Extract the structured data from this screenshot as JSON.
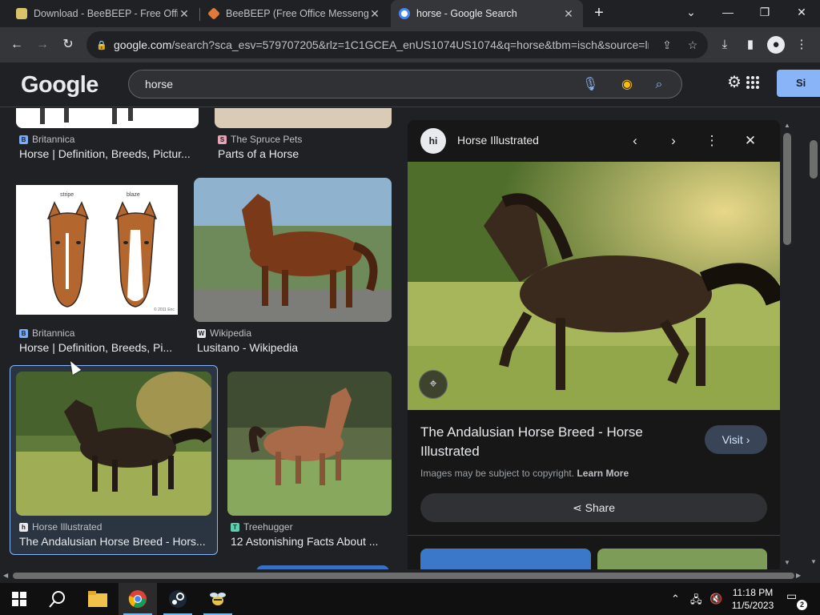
{
  "browser": {
    "tabs": [
      {
        "title": "Download - BeeBEEP - Free Offic"
      },
      {
        "title": "BeeBEEP (Free Office Messenger"
      },
      {
        "title": "horse - Google Search"
      }
    ],
    "url_host": "google.com",
    "url_path": "/search?sca_esv=579707205&rlz=1C1GCEA_enUS1074US1074&q=horse&tbm=isch&source=ln..."
  },
  "google": {
    "logo": "Google",
    "query": "horse",
    "signin_label": "Si"
  },
  "results": [
    {
      "source": "Britannica",
      "caption": "Horse | Definition, Breeds, Pictur..."
    },
    {
      "source": "The Spruce Pets",
      "caption": "Parts of a Horse"
    },
    {
      "source": "Britannica",
      "caption": "Horse | Definition, Breeds, Pi..."
    },
    {
      "source": "Wikipedia",
      "caption": "Lusitano - Wikipedia"
    },
    {
      "source": "Horse Illustrated",
      "caption": "The Andalusian Horse Breed - Hors..."
    },
    {
      "source": "Treehugger",
      "caption": "12 Astonishing Facts About ..."
    }
  ],
  "diagram_labels": {
    "left": "stripe",
    "right": "blaze",
    "copyright": "© 2011 Enc"
  },
  "preview": {
    "logo_text": "hi",
    "site_name": "Horse Illustrated",
    "title": "The Andalusian Horse Breed - Horse Illustrated",
    "visit_label": "Visit",
    "copyright_text": "Images may be subject to copyright.",
    "learn_more": "Learn More",
    "share_label": "Share"
  },
  "taskbar": {
    "time": "11:18 PM",
    "date": "11/5/2023",
    "notification_count": "2"
  },
  "colors": {
    "accent": "#8ab4f8",
    "bg": "#202124",
    "panel": "#171717"
  }
}
